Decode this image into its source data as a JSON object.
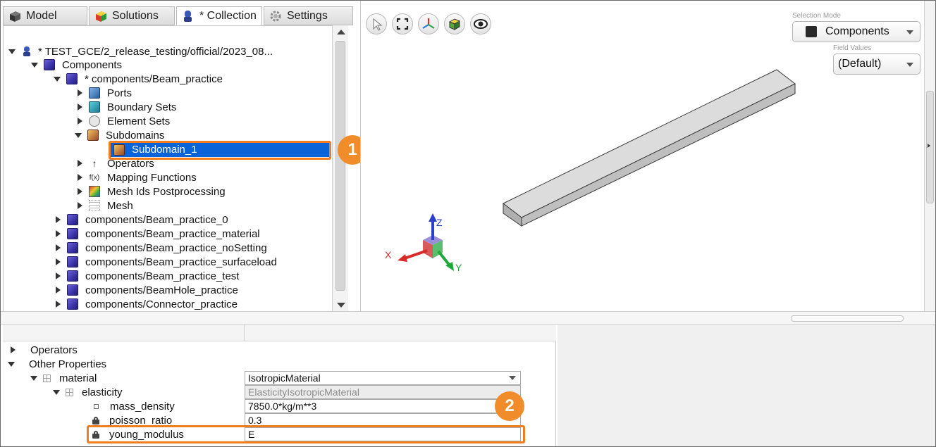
{
  "tabs": [
    {
      "label": "Model",
      "icon": "model-icon",
      "active": false
    },
    {
      "label": "Solutions",
      "icon": "solutions-icon",
      "active": false
    },
    {
      "label": "* Collection",
      "icon": "collection-icon",
      "active": true
    },
    {
      "label": "Settings",
      "icon": "gear-icon",
      "active": false
    }
  ],
  "tree": {
    "root": "* TEST_GCE/2_release_testing/official/2023_08...",
    "components": "Components",
    "beam": "* components/Beam_practice",
    "ports": "Ports",
    "boundary_sets": "Boundary Sets",
    "element_sets": "Element Sets",
    "subdomains": "Subdomains",
    "subdomain_1": "Subdomain_1",
    "operators": "Operators",
    "mapping_functions": "Mapping Functions",
    "mesh_ids": "Mesh Ids Postprocessing",
    "mesh": "Mesh",
    "others": [
      "components/Beam_practice_0",
      "components/Beam_practice_material",
      "components/Beam_practice_noSetting",
      "components/Beam_practice_surfaceload",
      "components/Beam_practice_test",
      "components/BeamHole_practice",
      "components/Connector_practice"
    ]
  },
  "viewport": {
    "selection_mode_label": "Selection Mode",
    "selection_mode_value": "Components",
    "field_values_label": "Field Values",
    "field_values_value": "(Default)",
    "axis_x": "X",
    "axis_y": "Y",
    "axis_z": "Z",
    "toolbar_icons": [
      "select-pointer-icon",
      "fit-view-icon",
      "axes-view-icon",
      "wireframe-cube-icon",
      "visibility-eye-icon"
    ]
  },
  "properties": {
    "operators": "Operators",
    "other_properties": "Other Properties",
    "material": "material",
    "material_value": "IsotropicMaterial",
    "elasticity": "elasticity",
    "elasticity_value": "ElasticityIsotropicMaterial",
    "mass_density": "mass_density",
    "mass_density_value": "7850.0*kg/m**3",
    "poisson_ratio": "poisson_ratio",
    "poisson_ratio_value": "0.3",
    "young_modulus": "young_modulus",
    "young_modulus_value": "E"
  },
  "badges": {
    "first": "1",
    "second": "2"
  },
  "colors": {
    "selection": "#0a64d8",
    "highlight": "#f07d20",
    "badge": "#f08c2a"
  }
}
